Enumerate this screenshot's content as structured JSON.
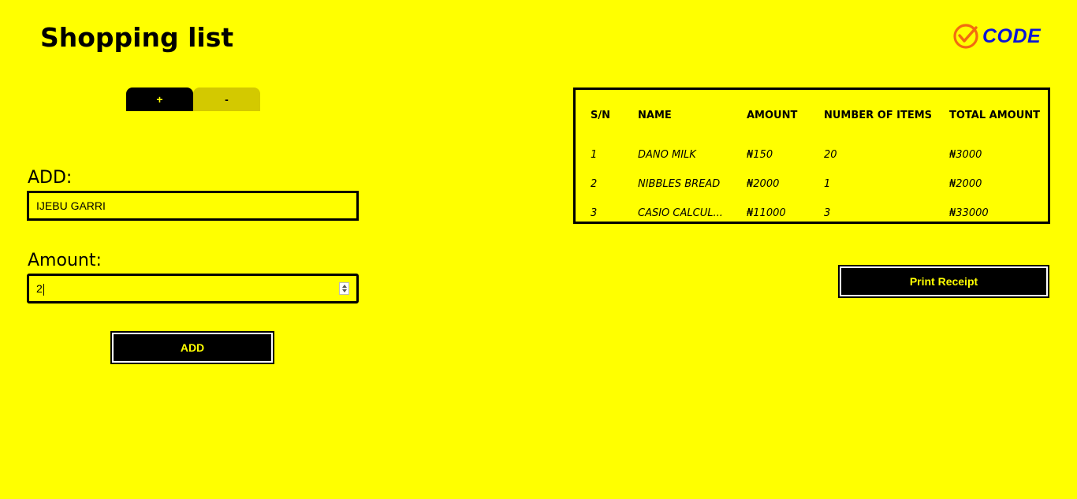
{
  "header": {
    "title": "Shopping list",
    "logo_text": "CODE",
    "logo_icon": "check-circle-icon"
  },
  "colors": {
    "background": "#ffff00",
    "dark": "#000000",
    "accent_text": "#ffff00",
    "inactive_tab": "#d3c900",
    "logo_text": "#0b14d8",
    "logo_icon": "#f26b10"
  },
  "tabs": [
    {
      "label": "+",
      "active": true
    },
    {
      "label": "-",
      "active": false
    }
  ],
  "form": {
    "add_label": "ADD:",
    "add_value": "IJEBU GARRI",
    "amount_label": "Amount:",
    "amount_value": "2",
    "add_button": "ADD"
  },
  "table": {
    "headers": [
      "S/N",
      "NAME",
      "AMOUNT",
      "NUMBER OF ITEMS",
      "TOTAL AMOUNT"
    ],
    "rows": [
      [
        "1",
        "DANO MILK",
        "₦150",
        "20",
        "₦3000"
      ],
      [
        "2",
        "NIBBLES BREAD",
        "₦2000",
        "1",
        "₦2000"
      ],
      [
        "3",
        "CASIO CALCUL...",
        "₦11000",
        "3",
        "₦33000"
      ]
    ]
  },
  "print_button": "Print Receipt"
}
